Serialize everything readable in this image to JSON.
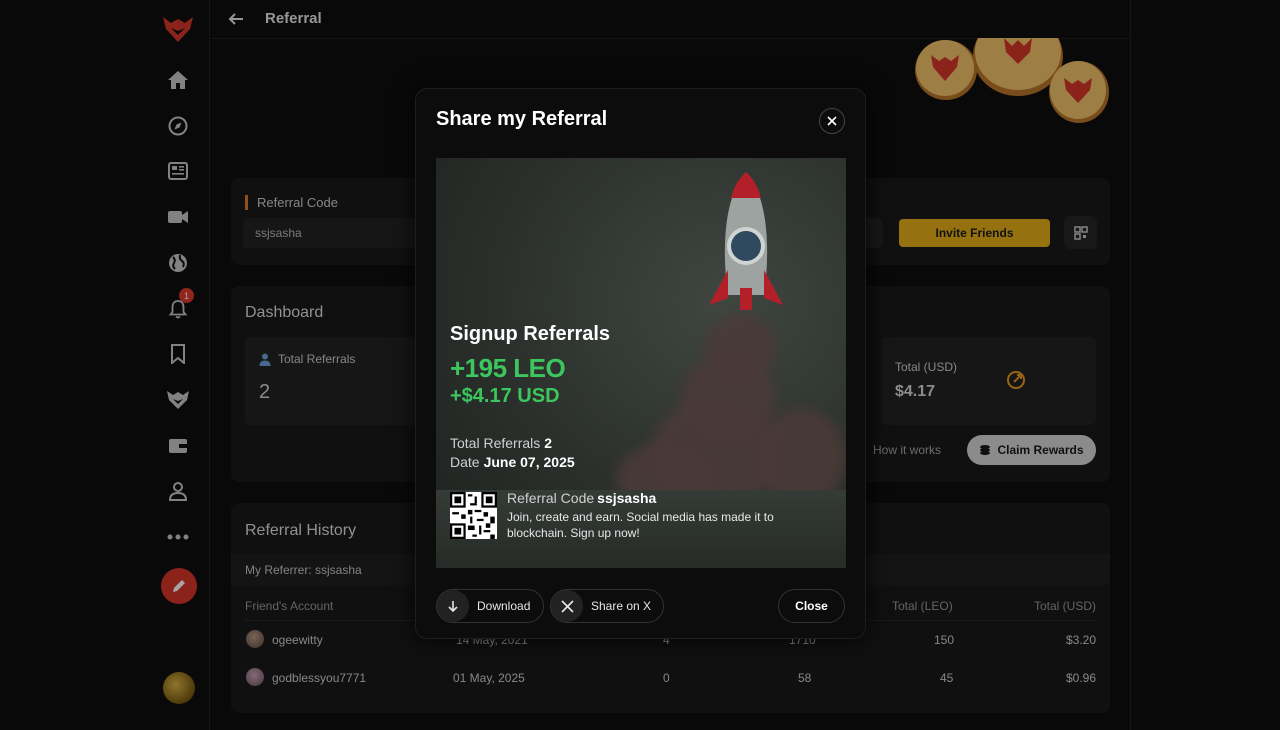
{
  "topbar": {
    "title": "Referral"
  },
  "sidebar": {
    "notification_count": "1"
  },
  "referral_code": {
    "label": "Referral Code",
    "value": "ssjsasha",
    "invite_label": "Invite Friends"
  },
  "dashboard": {
    "title": "Dashboard",
    "total_referrals_label": "Total Referrals",
    "total_referrals_value": "2",
    "total_usd_label": "Total (USD)",
    "total_usd_value": "$4.17",
    "how_it_works": "How it works",
    "claim_label": "Claim Rewards"
  },
  "history": {
    "title": "Referral History",
    "my_referrer": "My Referrer: ssjsasha",
    "columns": [
      "Friend's Account",
      "Total (LEO)",
      "Total (USD)"
    ],
    "rows": [
      {
        "account": "ogeewitty",
        "date": "14 May, 2021",
        "c3": "4",
        "c4": "1710",
        "leo": "150",
        "usd": "$3.20"
      },
      {
        "account": "godblessyou7771",
        "date": "01 May, 2025",
        "c3": "0",
        "c4": "58",
        "leo": "45",
        "usd": "$0.96"
      }
    ]
  },
  "modal": {
    "title": "Share my Referral",
    "card": {
      "heading": "Signup Referrals",
      "leo": "+195 LEO",
      "usd": "+$4.17 USD",
      "total_referrals_label": "Total Referrals",
      "total_referrals_value": "2",
      "date_label": "Date",
      "date_value": "June 07, 2025",
      "code_label": "Referral Code",
      "code_value": "ssjsasha",
      "description": "Join, create and earn. Social media has made it to blockchain. Sign up now!"
    },
    "download_label": "Download",
    "share_x_label": "Share on X",
    "close_label": "Close"
  }
}
